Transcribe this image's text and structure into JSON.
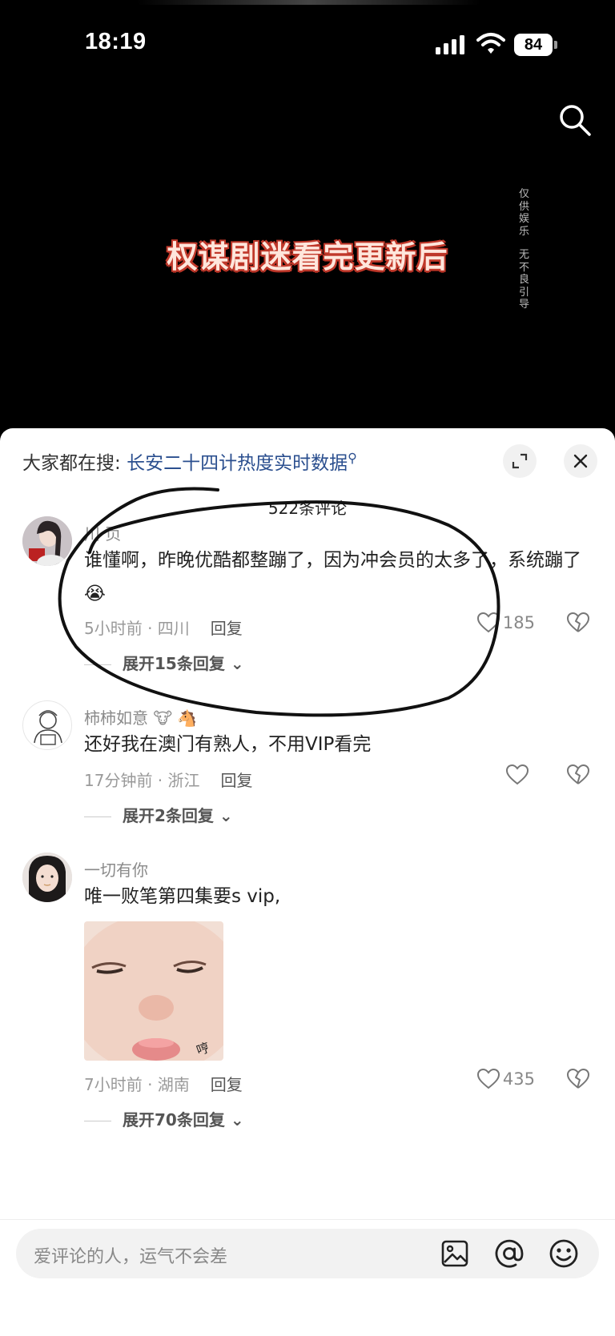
{
  "status_bar": {
    "time": "18:19",
    "battery": "84"
  },
  "video": {
    "caption": "权谋剧迷看完更新后",
    "disclaimer_lines": [
      "仅",
      "供",
      "娱",
      "乐",
      " ",
      "无",
      "不",
      "良",
      "引",
      "导"
    ]
  },
  "sheet": {
    "trending_prefix": "大家都在搜:",
    "trending_link": "长安二十四计热度实时数据",
    "comment_count": "522条评论"
  },
  "comments": [
    {
      "username": "川 页",
      "text": "谁懂啊，昨晚优酷都整蹦了，因为冲会员的太多了，系统蹦了😭",
      "meta": "5小时前 · 四川",
      "reply_label": "回复",
      "likes": "185",
      "expand": "展开15条回复"
    },
    {
      "username": "柿柿如意 🐮 🐴",
      "text": "还好我在澳门有熟人，不用VIP看完",
      "meta": "17分钟前 · 浙江",
      "reply_label": "回复",
      "likes": "",
      "expand": "展开2条回复"
    },
    {
      "username": "一切有你",
      "text": "唯一败笔第四集要s vip,",
      "meta": "7小时前 · 湖南",
      "reply_label": "回复",
      "likes": "435",
      "expand": "展开70条回复",
      "sticker_text": "哼"
    }
  ],
  "bottom_bar": {
    "placeholder": "爱评论的人，运气不会差"
  },
  "icons": {
    "search": "search-icon",
    "expand": "expand-icon",
    "close": "close-icon",
    "like": "heart-icon",
    "dislike": "broken-heart-icon",
    "image": "image-icon",
    "mention": "at-icon",
    "emoji": "emoji-icon"
  },
  "colors": {
    "link": "#2b4f8f",
    "caption": "#c0392b"
  }
}
